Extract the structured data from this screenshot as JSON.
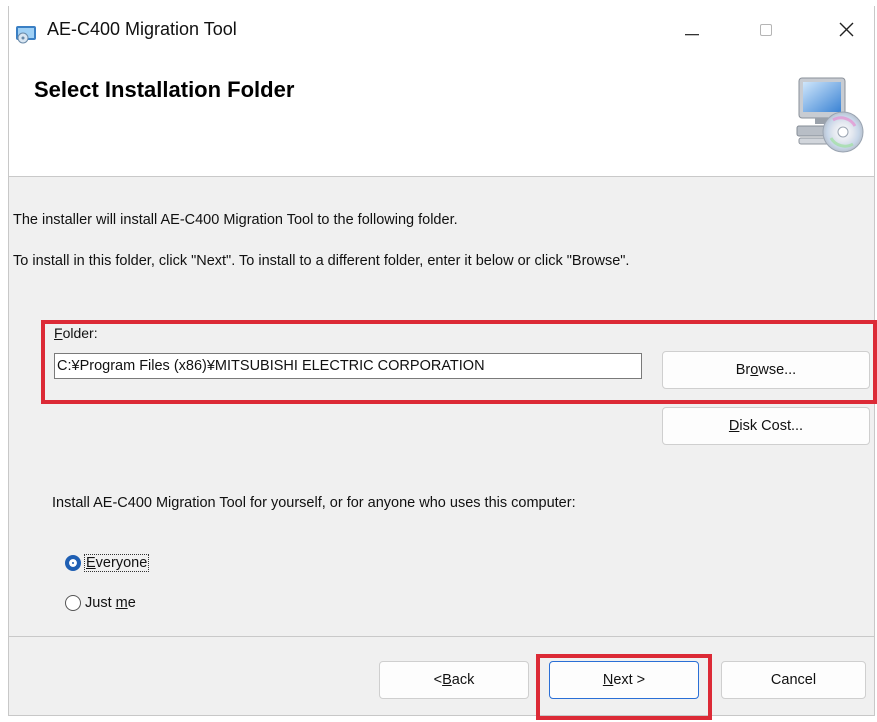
{
  "window": {
    "title": "AE-C400 Migration Tool",
    "minimize_glyph": "—",
    "maximize_glyph": "☐",
    "close_glyph": "✕"
  },
  "header": {
    "title": "Select Installation Folder",
    "icon": "computer-cd-icon"
  },
  "body": {
    "info_line1": "The installer will install AE-C400 Migration Tool to the following folder.",
    "info_line2": "To install in this folder, click \"Next\". To install to a different folder, enter it below or click \"Browse\".",
    "folder_label_mnemonic": "F",
    "folder_label_rest": "older:",
    "folder_value": "C:¥Program Files (x86)¥MITSUBISHI ELECTRIC CORPORATION",
    "browse_prefix": "Br",
    "browse_mnemonic": "o",
    "browse_suffix": "wse...",
    "disk_mnemonic": "D",
    "disk_rest": "isk Cost...",
    "install_for_text": "Install AE-C400 Migration Tool for yourself, or for anyone who uses this computer:",
    "radio_options": {
      "everyone": {
        "mnemonic": "E",
        "rest": "veryone",
        "selected": true
      },
      "justme": {
        "prefix": "Just ",
        "mnemonic": "m",
        "rest": "e",
        "selected": false
      }
    }
  },
  "footer": {
    "back_prefix": "< ",
    "back_mnemonic": "B",
    "back_rest": "ack",
    "next_mnemonic": "N",
    "next_rest": "ext >",
    "cancel_label": "Cancel"
  },
  "colors": {
    "highlight": "#dc2a36",
    "radio_selected": "#1f5fb3",
    "default_button_border": "#2a6fd6"
  }
}
